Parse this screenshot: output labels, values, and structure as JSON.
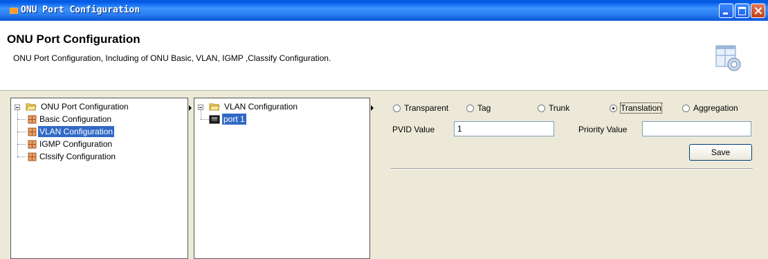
{
  "window": {
    "title": "ONU Port Configuration"
  },
  "header": {
    "title": "ONU Port Configuration",
    "description": "ONU Port Configuration, Including of ONU Basic, VLAN, IGMP ,Classify Configuration."
  },
  "left_tree": {
    "root": "ONU Port Configuration",
    "items": [
      "Basic Configuration",
      "VLAN Configuration",
      "IGMP Configuration",
      "Clssify Configuration"
    ],
    "selected": "VLAN Configuration"
  },
  "mid_tree": {
    "root": "VLAN Configuration",
    "items": [
      "port 1"
    ],
    "selected": "port 1"
  },
  "vlan_mode": {
    "options": [
      "Transparent",
      "Tag",
      "Trunk",
      "Translation",
      "Aggregation"
    ],
    "selected": "Translation"
  },
  "form": {
    "pvid_label": "PVID Value",
    "pvid_value": "1",
    "priority_label": "Priority Value",
    "priority_value": "",
    "save_label": "Save"
  },
  "colors": {
    "selection": "#316ac5",
    "titlebar": "#0058e6",
    "background": "#ece9d8"
  }
}
